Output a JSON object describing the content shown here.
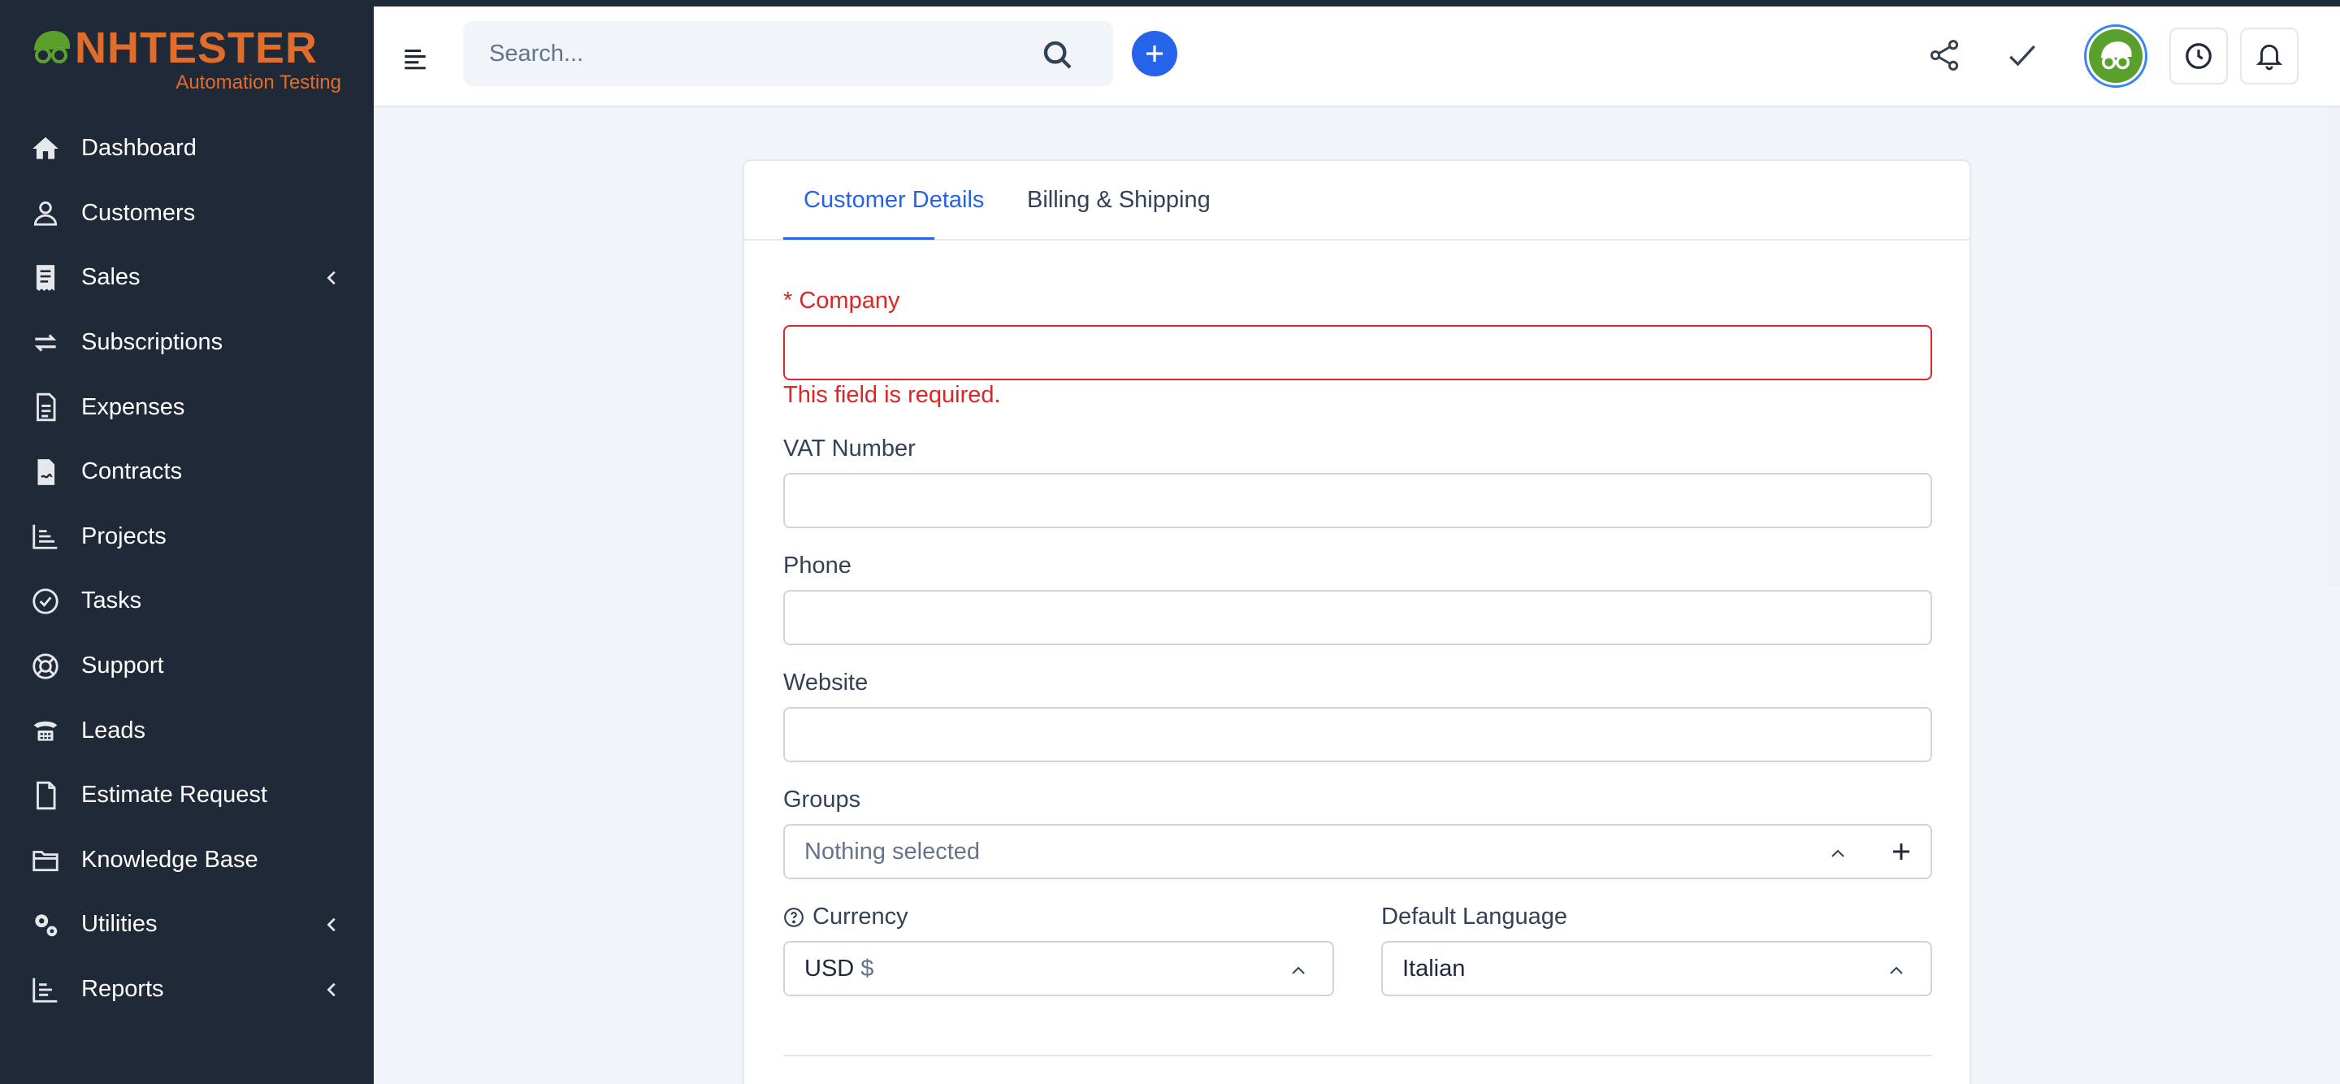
{
  "brand": {
    "name_lead": "A",
    "name_rest": "NHTESTER",
    "tagline": "Automation Testing"
  },
  "sidebar": {
    "items": [
      {
        "label": "Dashboard",
        "icon": "home-icon"
      },
      {
        "label": "Customers",
        "icon": "user-icon"
      },
      {
        "label": "Sales",
        "icon": "receipt-icon",
        "has_submenu": true
      },
      {
        "label": "Subscriptions",
        "icon": "refresh-icon"
      },
      {
        "label": "Expenses",
        "icon": "document-icon"
      },
      {
        "label": "Contracts",
        "icon": "contract-icon"
      },
      {
        "label": "Projects",
        "icon": "chart-icon"
      },
      {
        "label": "Tasks",
        "icon": "check-circle-icon"
      },
      {
        "label": "Support",
        "icon": "lifebuoy-icon"
      },
      {
        "label": "Leads",
        "icon": "phone-icon"
      },
      {
        "label": "Estimate Request",
        "icon": "file-icon"
      },
      {
        "label": "Knowledge Base",
        "icon": "folder-icon"
      },
      {
        "label": "Utilities",
        "icon": "cogs-icon",
        "has_submenu": true
      },
      {
        "label": "Reports",
        "icon": "reports-icon",
        "has_submenu": true
      }
    ]
  },
  "header": {
    "search_placeholder": "Search..."
  },
  "tabs": [
    {
      "label": "Customer Details",
      "active": true
    },
    {
      "label": "Billing & Shipping",
      "active": false
    }
  ],
  "form": {
    "company": {
      "required_mark": "*",
      "label": "Company",
      "value": "",
      "error": "This field is required."
    },
    "vat": {
      "label": "VAT Number",
      "value": ""
    },
    "phone": {
      "label": "Phone",
      "value": ""
    },
    "website": {
      "label": "Website",
      "value": ""
    },
    "groups": {
      "label": "Groups",
      "placeholder": "Nothing selected"
    },
    "currency": {
      "label": "Currency",
      "value": "USD",
      "symbol": "$"
    },
    "language": {
      "label": "Default Language",
      "value": "Italian"
    }
  },
  "colors": {
    "sidebar_bg": "#1f2937",
    "accent": "#2563eb",
    "error": "#dc2626",
    "brand_orange": "#e06d2a",
    "brand_green": "#5aa02c"
  }
}
